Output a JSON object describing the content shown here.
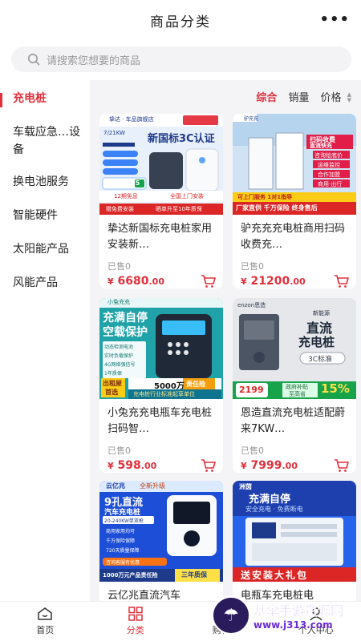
{
  "header": {
    "title": "商品分类",
    "more": "•••"
  },
  "search": {
    "placeholder": "请搜索您想要的商品"
  },
  "sidebar": {
    "items": [
      {
        "label": "充电桩"
      },
      {
        "label": "车载应急…设备"
      },
      {
        "label": "换电池服务"
      },
      {
        "label": "智能硬件"
      },
      {
        "label": "太阳能产品"
      },
      {
        "label": "风能产品"
      }
    ]
  },
  "sort": {
    "comprehensive": "综合",
    "sales": "销量",
    "price": "价格"
  },
  "products": [
    {
      "name": "挚达新国标充电桩家用安装新…",
      "sold": "已售0",
      "price_symbol": "¥",
      "price_int": "6680",
      "price_dec": ".00",
      "img": {
        "brand": "挚达 · 车品旗舰店",
        "spec": "7/21KW",
        "headline": "新国标3C认证",
        "badge": "1.5",
        "bottom1": "赠免费安装",
        "bottom2": "晒单升至10年质保",
        "tag1": "12期免息",
        "tag2": "全国上门安装"
      }
    },
    {
      "name": "驴充充充电桩商用扫码收费充…",
      "sold": "已售0",
      "price_symbol": "¥",
      "price_int": "21200",
      "price_dec": ".00",
      "img": {
        "brand": "驴充充",
        "tag1": "扫码收费",
        "tag2": "直流快充",
        "tag3": "咨询给底价",
        "tag4": "运维监控",
        "tag5": "合作加盟",
        "tag6": "商用·出行",
        "strip1": "可上门服务 1对1指导",
        "strip2": "厂家直供 千万保险 终身售后"
      }
    },
    {
      "name": "小兔充充电瓶车充电桩扫码智…",
      "sold": "已售0",
      "price_symbol": "¥",
      "price_int": "598",
      "price_dec": ".00",
      "img": {
        "brand": "小兔充充",
        "headline1": "充满自停",
        "headline2": "空载保护",
        "f1": "动态检测电池",
        "f2": "实时负载保护",
        "f3": "4G网络强信号",
        "f4": "1年质保",
        "promo1": "出租屋",
        "promo2": "首选",
        "price": "5000万",
        "insurance": "责任险",
        "footer": "充电桩行业标准起草单位"
      }
    },
    {
      "name": "恩造直流充电桩适配蔚来7KW…",
      "sold": "已售0",
      "price_symbol": "¥",
      "price_int": "7999",
      "price_dec": ".00",
      "img": {
        "brand": "enzon恩造",
        "sub": "新能源",
        "headline1": "直流",
        "headline2": "充电桩",
        "std": "3C标准",
        "price": "2199",
        "gov": "政府补贴",
        "gov2": "至高省",
        "pct": "15%"
      }
    },
    {
      "name": "云亿兆直流汽车",
      "sold": "",
      "price_symbol": "",
      "price_int": "",
      "price_dec": "",
      "img": {
        "brand": "云亿兆",
        "tag": "全新升级",
        "headline1": "9孔直流",
        "headline2": "汽车充电桩",
        "range": "20-240KW单双枪",
        "f1": "商用家用均可",
        "f2": "千万保险保障",
        "f3": "720天质量保障",
        "call": "咨询客服有优惠",
        "bottom1": "1000万元产品责任险",
        "bottom2": "三年质保"
      }
    },
    {
      "name": "电瓶车充电桩电",
      "sold": "",
      "price_symbol": "",
      "price_int": "",
      "price_dec": "",
      "img": {
        "brand": "洲茵",
        "headline1": "充满自停",
        "headline2": "安全充电 · 免费断电",
        "bottom": "送安装大礼包"
      }
    }
  ],
  "tabbar": {
    "items": [
      {
        "label": "首页"
      },
      {
        "label": "分类"
      },
      {
        "label": "购物车"
      },
      {
        "label": "个人中心"
      }
    ]
  },
  "watermark": {
    "text": "基伞手游资源网",
    "url": "www.j313.com"
  },
  "colors": {
    "accent": "#e0303c",
    "background": "#f4f4f6",
    "watermark": "#6b2bd6"
  }
}
